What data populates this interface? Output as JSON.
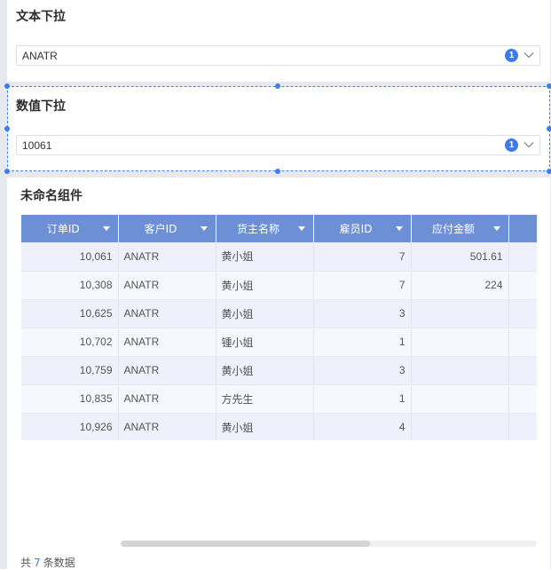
{
  "text_dropdown": {
    "title": "文本下拉",
    "value": "ANATR",
    "badge": "1"
  },
  "number_dropdown": {
    "title": "数值下拉",
    "value": "10061",
    "badge": "1"
  },
  "table_widget": {
    "title": "未命名组件",
    "columns": [
      "订单ID",
      "客户ID",
      "货主名称",
      "雇员ID",
      "应付金额"
    ],
    "rows": [
      [
        "10,061",
        "ANATR",
        "黄小姐",
        "7",
        "501.61"
      ],
      [
        "10,308",
        "ANATR",
        "黄小姐",
        "7",
        "224"
      ],
      [
        "10,625",
        "ANATR",
        "黄小姐",
        "3",
        ""
      ],
      [
        "10,702",
        "ANATR",
        "锺小姐",
        "1",
        ""
      ],
      [
        "10,759",
        "ANATR",
        "黄小姐",
        "3",
        ""
      ],
      [
        "10,835",
        "ANATR",
        "方先生",
        "1",
        ""
      ],
      [
        "10,926",
        "ANATR",
        "黄小姐",
        "4",
        ""
      ]
    ],
    "footer": {
      "prefix": "共",
      "count": "7",
      "suffix": "条数据"
    },
    "scroll_position": 0.6
  },
  "colors": {
    "header_bg": "#6c8fd6",
    "accent": "#3a7cf0",
    "selection": "#3d7df4"
  }
}
